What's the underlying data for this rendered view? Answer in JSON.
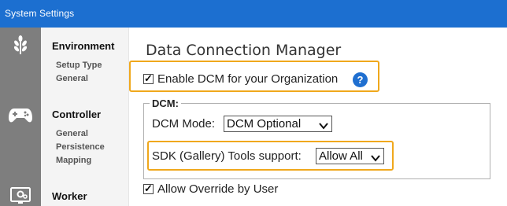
{
  "window": {
    "title": "System Settings"
  },
  "rail": {
    "icons": [
      "leaf-icon",
      "gamepad-icon",
      "worker-monitor-icon"
    ]
  },
  "nav": {
    "sections": [
      {
        "label": "Environment",
        "items": [
          "Setup Type",
          "General"
        ]
      },
      {
        "label": "Controller",
        "items": [
          "General",
          "Persistence",
          "Mapping"
        ]
      },
      {
        "label": "Worker",
        "items": []
      }
    ]
  },
  "main": {
    "title": "Data Connection Manager",
    "enable_dcm": {
      "label": "Enable DCM for your Organization",
      "checked": true,
      "help": "?"
    },
    "dcm_group": {
      "legend": "DCM:",
      "mode": {
        "label": "DCM Mode:",
        "value": "DCM Optional"
      },
      "sdk": {
        "label": "SDK (Gallery) Tools support:",
        "value": "Allow All"
      }
    },
    "allow_override": {
      "label": "Allow Override by User",
      "checked": true
    }
  },
  "colors": {
    "titlebar": "#1c6fd0",
    "rail": "#7e7e7e",
    "highlight": "#f0a81c",
    "help": "#1f6fd0"
  }
}
